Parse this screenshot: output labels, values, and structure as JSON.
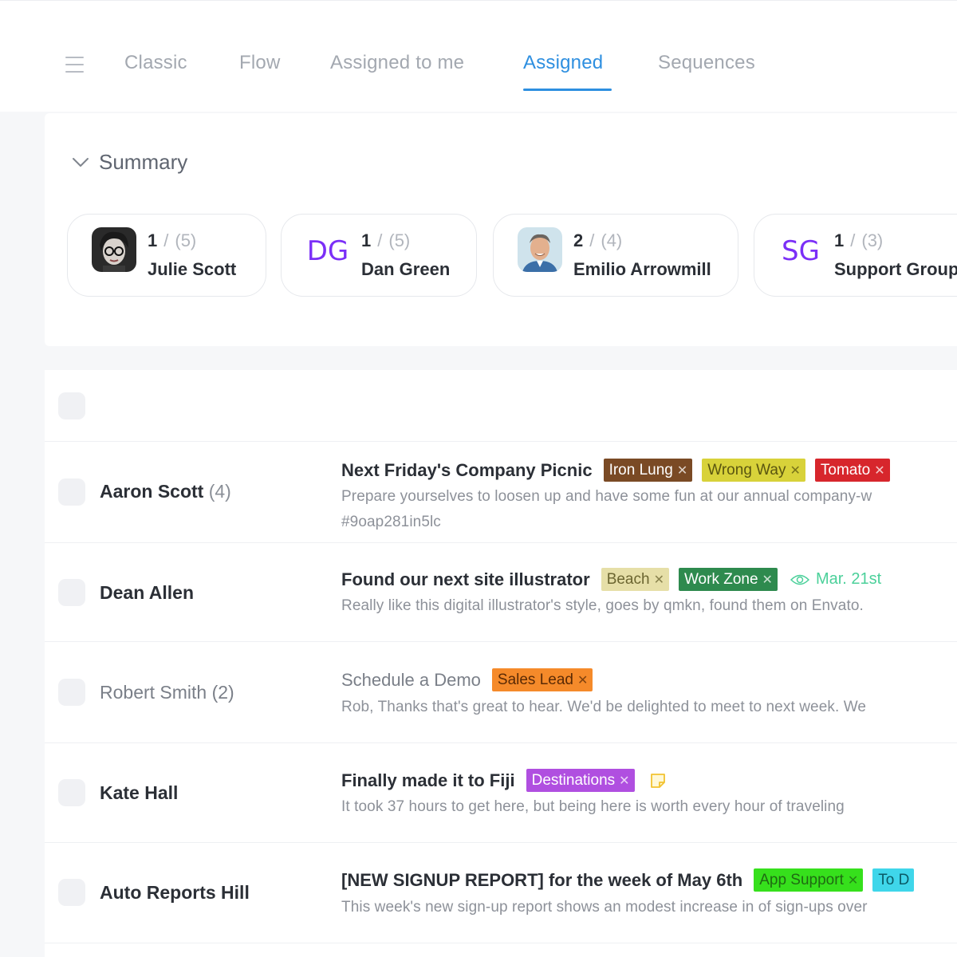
{
  "tabs": [
    {
      "label": "Classic"
    },
    {
      "label": "Flow"
    },
    {
      "label": "Assigned to me"
    },
    {
      "label": "Assigned",
      "active": true
    },
    {
      "label": "Sequences"
    }
  ],
  "accent_color": "#2e8fe0",
  "summary": {
    "title": "Summary",
    "cards": [
      {
        "count": "1",
        "separator": "/",
        "total": "(5)",
        "name": "Julie Scott",
        "avatar": "photo"
      },
      {
        "count": "1",
        "separator": "/",
        "total": "(5)",
        "name": "Dan Green",
        "initials": "DG"
      },
      {
        "count": "2",
        "separator": "/",
        "total": "(4)",
        "name": "Emilio Arrowmill",
        "avatar": "photo"
      },
      {
        "count": "1",
        "separator": "/",
        "total": "(3)",
        "name": "Support Group",
        "initials": "SG"
      }
    ]
  },
  "rows": [
    {
      "sender": "Aaron Scott",
      "sender_count": "(4)",
      "unread": true,
      "subject": "Next Friday's Company Picnic",
      "tags": [
        {
          "label": "Iron Lung",
          "bg": "#7a4a25",
          "fg": "#ffffff"
        },
        {
          "label": "Wrong Way",
          "bg": "#d8d23a",
          "fg": "#5a5510"
        },
        {
          "label": "Tomato",
          "bg": "#d7262c",
          "fg": "#ffffff"
        }
      ],
      "preview": "Prepare yourselves to loosen up and have some fun at our annual company-w",
      "preview2": "#9oap281in5lc"
    },
    {
      "sender": "Dean Allen",
      "unread": true,
      "subject": "Found our next site illustrator",
      "tags": [
        {
          "label": "Beach",
          "bg": "#e6dfa8",
          "fg": "#6b6530"
        },
        {
          "label": "Work Zone",
          "bg": "#2e8a4e",
          "fg": "#ffffff"
        }
      ],
      "date": "Mar. 21st",
      "preview": "Really like this digital illustrator's style, goes by qmkn, found them on Envato."
    },
    {
      "sender": "Robert Smith (2)",
      "unread": false,
      "subject": "Schedule a Demo",
      "tags": [
        {
          "label": "Sales Lead",
          "bg": "#f58a2a",
          "fg": "#5a2a05"
        }
      ],
      "preview": "Rob, Thanks that's great to hear. We'd be delighted to meet to next week. We"
    },
    {
      "sender": "Kate Hall",
      "unread": true,
      "subject": "Finally made it to Fiji",
      "tags": [
        {
          "label": "Destinations",
          "bg": "#b04fe0",
          "fg": "#ffffff"
        }
      ],
      "preview": "It took 37 hours to get here, but being here is worth every hour of traveling"
    },
    {
      "sender": "Auto Reports Hill",
      "unread": true,
      "subject": "[NEW SIGNUP REPORT] for the week of May 6th",
      "tags": [
        {
          "label": "App Support",
          "bg": "#36e01c",
          "fg": "#1f6a12"
        },
        {
          "label": "To D",
          "bg": "#3fd6ea",
          "fg": "#0a5a66"
        }
      ],
      "preview": "This week's new sign-up report shows an modest increase in of sign-ups over"
    }
  ]
}
